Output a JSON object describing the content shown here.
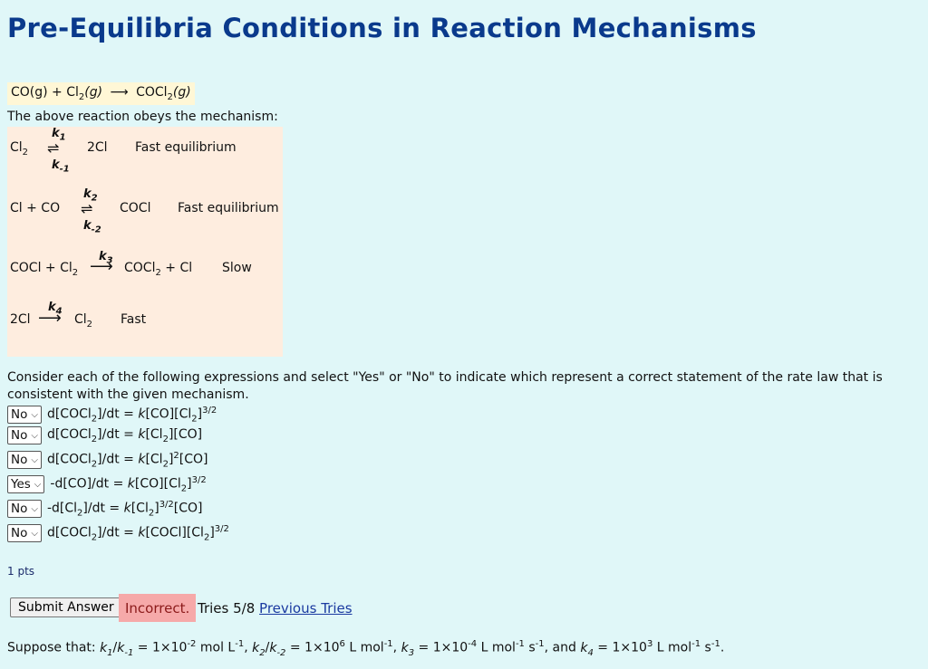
{
  "title": "Pre-Equilibria Conditions in Reaction Mechanisms",
  "reaction": {
    "lhs": "CO(g) + Cl",
    "lhs_sub": "2",
    "lhs_tail": "(g)",
    "arrow": "⟶",
    "rhs": "COCl",
    "rhs_sub": "2",
    "rhs_tail": "(g)"
  },
  "obeys_text": "The above reaction obeys the mechanism:",
  "mechanism": {
    "step1": {
      "reactants": "Cl",
      "reactants_sub": "2",
      "k_fwd": "k",
      "k_fwd_sub": "1",
      "k_rev": "k",
      "k_rev_sub": "-1",
      "products": "2Cl",
      "note": "Fast equilibrium"
    },
    "step2": {
      "reactants": "Cl + CO",
      "k_fwd": "k",
      "k_fwd_sub": "2",
      "k_rev": "k",
      "k_rev_sub": "-2",
      "products": "COCl",
      "note": "Fast equilibrium"
    },
    "step3": {
      "reactants": "COCl + Cl",
      "reactants_sub": "2",
      "k": "k",
      "k_sub": "3",
      "products_a": "COCl",
      "products_sub": "2",
      "products_b": " + Cl",
      "note": "Slow"
    },
    "step4": {
      "reactants": "2Cl",
      "k": "k",
      "k_sub": "4",
      "products": "Cl",
      "products_sub": "2",
      "note": "Fast"
    }
  },
  "question_text": "Consider each of the following expressions and select \"Yes\" or \"No\" to indicate which represent a correct statement of the rate law that is consistent with the given mechanism.",
  "options": [
    "No",
    "No",
    "No",
    "Yes",
    "No",
    "No"
  ],
  "pts_label": "1 pts",
  "submit_label": "Submit Answer",
  "status_label": "Incorrect.",
  "tries_label": "Tries 5/8",
  "previous_tries_label": "Previous Tries",
  "suppose_prefix": "Suppose that: "
}
